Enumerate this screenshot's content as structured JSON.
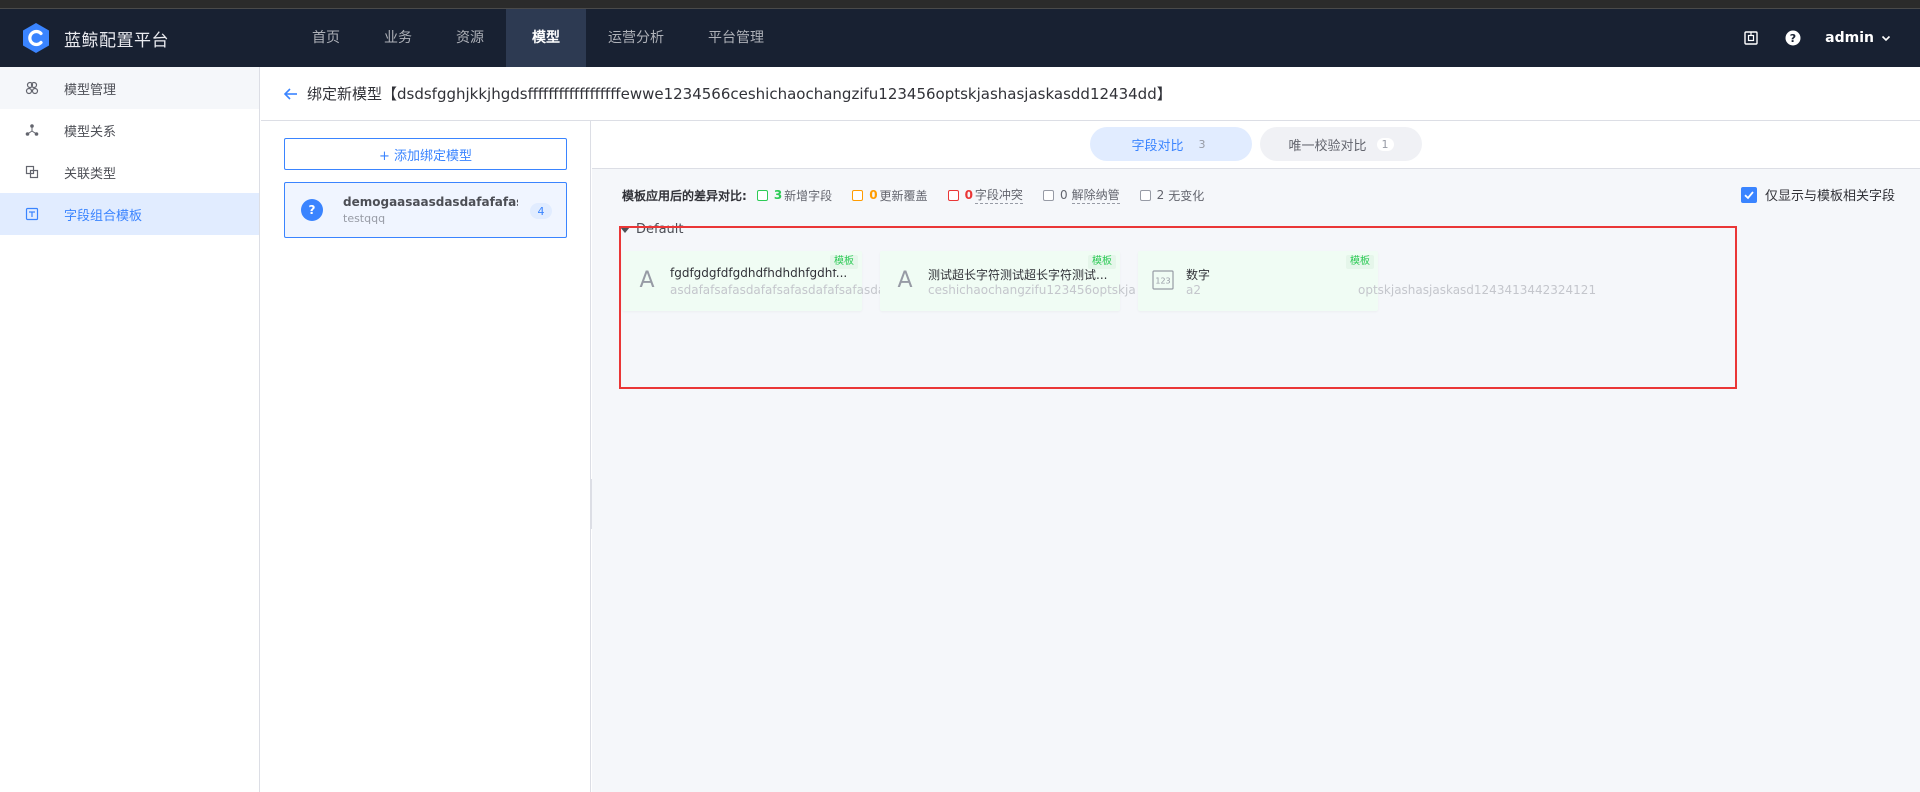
{
  "app": {
    "title": "蓝鲸配置平台"
  },
  "nav": {
    "items": [
      {
        "label": "首页",
        "active": false
      },
      {
        "label": "业务",
        "active": false
      },
      {
        "label": "资源",
        "active": false
      },
      {
        "label": "模型",
        "active": true
      },
      {
        "label": "运营分析",
        "active": false
      },
      {
        "label": "平台管理",
        "active": false
      }
    ],
    "right_icons": [
      "component-icon",
      "help-icon"
    ],
    "user": "admin"
  },
  "sidebar": {
    "items": [
      {
        "label": "模型管理",
        "icon": "model-manage-icon"
      },
      {
        "label": "模型关系",
        "icon": "model-relation-icon"
      },
      {
        "label": "关联类型",
        "icon": "association-type-icon"
      },
      {
        "label": "字段组合模板",
        "icon": "field-template-icon",
        "active": true
      }
    ]
  },
  "header": {
    "title": "绑定新模型【dsdsfgghjkkjhgdsffffffffffffffffffewwe1234566ceshichaochangzifu123456optskjashasjaskasdd12434dd】"
  },
  "left_panel": {
    "add_button": "+ 添加绑定模型",
    "model": {
      "name": "demogaasaasdasdafafafas...",
      "sub": "testqqq",
      "count": "4",
      "icon_text": "?"
    }
  },
  "tabs": [
    {
      "label": "字段对比",
      "count": "3",
      "active": true
    },
    {
      "label": "唯一校验对比",
      "count": "1",
      "active": false
    }
  ],
  "diff": {
    "label": "模板应用后的差异对比:",
    "legend": [
      {
        "num": "3",
        "text": "新增字段",
        "color": "#2dcb56",
        "dashed": false
      },
      {
        "num": "0",
        "text": "更新覆盖",
        "color": "#ff9c01",
        "dashed": false
      },
      {
        "num": "0",
        "text": "字段冲突",
        "color": "#ea3636",
        "dashed": true
      },
      {
        "num": "0",
        "text": "解除纳管",
        "color": "#979ba5",
        "dashed": true
      },
      {
        "num": "2",
        "text": "无变化",
        "color": "#979ba5",
        "dashed": false
      }
    ],
    "only_related": "仅显示与模板相关字段"
  },
  "group": {
    "title": "Default",
    "fields": [
      {
        "name": "fgdfgdgfdfgdhdfhdhdhfgdhf...",
        "id": "asdafafsafasdafafsafasdafafsafasdafa",
        "tag": "模板",
        "icon_text": "A"
      },
      {
        "name": "测试超长字符测试超长字符测试...",
        "id": "ceshichaochangzifu123456optskja",
        "tag": "模板",
        "icon_text": "A"
      },
      {
        "name": "数字",
        "id": "a2",
        "tag": "模板",
        "icon_text": "123"
      }
    ],
    "spill_text": "optskjashasjaskasd1243413442324121"
  }
}
